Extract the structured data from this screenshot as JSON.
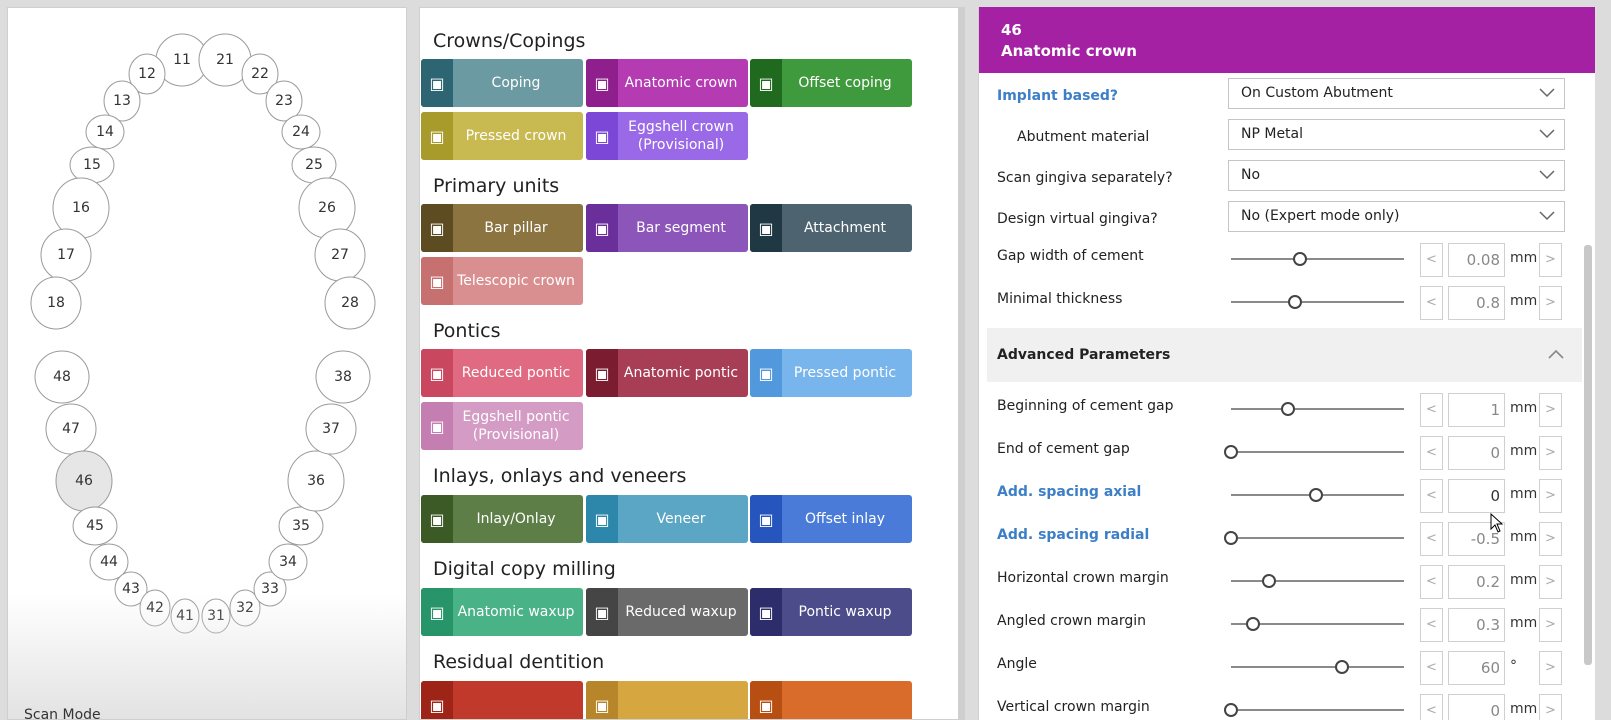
{
  "tooth_chart": {
    "teeth": [
      {
        "label": "11",
        "selected": false
      },
      {
        "label": "12",
        "selected": false
      },
      {
        "label": "13",
        "selected": false
      },
      {
        "label": "14",
        "selected": false
      },
      {
        "label": "15",
        "selected": false
      },
      {
        "label": "16",
        "selected": false
      },
      {
        "label": "17",
        "selected": false
      },
      {
        "label": "18",
        "selected": false
      },
      {
        "label": "21",
        "selected": false
      },
      {
        "label": "22",
        "selected": false
      },
      {
        "label": "23",
        "selected": false
      },
      {
        "label": "24",
        "selected": false
      },
      {
        "label": "25",
        "selected": false
      },
      {
        "label": "26",
        "selected": false
      },
      {
        "label": "27",
        "selected": false
      },
      {
        "label": "28",
        "selected": false
      },
      {
        "label": "48",
        "selected": false
      },
      {
        "label": "47",
        "selected": false
      },
      {
        "label": "46",
        "selected": true
      },
      {
        "label": "45",
        "selected": false
      },
      {
        "label": "44",
        "selected": false
      },
      {
        "label": "43",
        "selected": false
      },
      {
        "label": "42",
        "selected": false
      },
      {
        "label": "41",
        "selected": false
      },
      {
        "label": "31",
        "selected": false
      },
      {
        "label": "32",
        "selected": false
      },
      {
        "label": "33",
        "selected": false
      },
      {
        "label": "34",
        "selected": false
      },
      {
        "label": "35",
        "selected": false
      },
      {
        "label": "36",
        "selected": false
      },
      {
        "label": "37",
        "selected": false
      },
      {
        "label": "38",
        "selected": false
      }
    ],
    "scan_mode": "Scan Mode"
  },
  "types": {
    "sections": [
      {
        "title": "Crowns/Copings",
        "buttons": [
          {
            "label": "Coping",
            "color": "#6b9aa3",
            "icon_color": "#2d6672",
            "icon": "coping-icon"
          },
          {
            "label": "Anatomic crown",
            "color": "#b43bb2",
            "icon_color": "#8e1f8d",
            "icon": "anatomic-crown-icon"
          },
          {
            "label": "Offset coping",
            "color": "#3f9a3d",
            "icon_color": "#1f6a1f",
            "icon": "offset-coping-icon"
          },
          {
            "label": "Pressed crown",
            "color": "#c9b951",
            "icon_color": "#a99a2c",
            "icon": "pressed-crown-icon"
          },
          {
            "label": "Eggshell crown (Provisional)",
            "color": "#9a69e8",
            "icon_color": "#7c47d6",
            "icon": "eggshell-crown-icon"
          }
        ]
      },
      {
        "title": "Primary units",
        "buttons": [
          {
            "label": "Bar pillar",
            "color": "#8b7440",
            "icon_color": "#5d4b22",
            "icon": "bar-pillar-icon"
          },
          {
            "label": "Bar segment",
            "color": "#8c55ba",
            "icon_color": "#6a2f9a",
            "icon": "bar-segment-icon"
          },
          {
            "label": "Attachment",
            "color": "#4e6370",
            "icon_color": "#1f3844",
            "icon": "attachment-icon"
          },
          {
            "label": "Telescopic crown",
            "color": "#d98f8f",
            "icon_color": "#c77070",
            "icon": "telescopic-crown-icon"
          }
        ]
      },
      {
        "title": "Pontics",
        "buttons": [
          {
            "label": "Reduced pontic",
            "color": "#e06a81",
            "icon_color": "#c9475f",
            "icon": "reduced-pontic-icon"
          },
          {
            "label": "Anatomic pontic",
            "color": "#a73e55",
            "icon_color": "#7c1c30",
            "icon": "anatomic-pontic-icon"
          },
          {
            "label": "Pressed pontic",
            "color": "#78b5ec",
            "icon_color": "#5199dc",
            "icon": "pressed-pontic-icon"
          },
          {
            "label": "Eggshell pontic (Provisional)",
            "color": "#d49cc4",
            "icon_color": "#c57eb2",
            "icon": "eggshell-pontic-icon"
          }
        ]
      },
      {
        "title": "Inlays, onlays and veneers",
        "buttons": [
          {
            "label": "Inlay/Onlay",
            "color": "#5e7e48",
            "icon_color": "#3b5a25",
            "icon": "inlay-onlay-icon"
          },
          {
            "label": "Veneer",
            "color": "#5aa6c4",
            "icon_color": "#2d87ab",
            "icon": "veneer-icon"
          },
          {
            "label": "Offset inlay",
            "color": "#4b7bd8",
            "icon_color": "#2555bd",
            "icon": "offset-inlay-icon"
          }
        ]
      },
      {
        "title": "Digital copy milling",
        "buttons": [
          {
            "label": "Anatomic waxup",
            "color": "#49b387",
            "icon_color": "#27946a",
            "icon": "anatomic-waxup-icon"
          },
          {
            "label": "Reduced waxup",
            "color": "#6a6a6a",
            "icon_color": "#454545",
            "icon": "reduced-waxup-icon"
          },
          {
            "label": "Pontic waxup",
            "color": "#4c4c8a",
            "icon_color": "#2d2d6b",
            "icon": "pontic-waxup-icon"
          }
        ]
      },
      {
        "title": "Residual dentition",
        "buttons": [
          {
            "label": "",
            "color": "#c0392b",
            "icon_color": "#9e2418",
            "icon": "residual-icon-1"
          },
          {
            "label": "",
            "color": "#d6a640",
            "icon_color": "#b8862a",
            "icon": "residual-icon-2"
          },
          {
            "label": "",
            "color": "#d96c2a",
            "icon_color": "#b84f12",
            "icon": "residual-icon-3"
          }
        ]
      }
    ]
  },
  "params": {
    "header": {
      "tooth": "46",
      "type": "Anatomic crown",
      "color": "#a421a3"
    },
    "dropdowns": [
      {
        "label": "Implant based?",
        "value": "On Custom Abutment",
        "blue": true,
        "indent": false
      },
      {
        "label": "Abutment material",
        "value": "NP Metal",
        "blue": false,
        "indent": true
      },
      {
        "label": "Scan gingiva separately?",
        "value": "No",
        "blue": false,
        "indent": false
      },
      {
        "label": "Design virtual gingiva?",
        "value": "No (Expert mode only)",
        "blue": false,
        "indent": false
      }
    ],
    "basic_sliders": [
      {
        "label": "Gap width of cement",
        "value": "0.08",
        "unit": "mm",
        "level": 0.4,
        "blue": false,
        "active": false
      },
      {
        "label": "Minimal thickness",
        "value": "0.8",
        "unit": "mm",
        "level": 0.37,
        "blue": false,
        "active": false
      }
    ],
    "advanced_title": "Advanced Parameters",
    "advanced_sliders": [
      {
        "label": "Beginning of cement gap",
        "value": "1",
        "unit": "mm",
        "level": 0.33,
        "blue": false,
        "active": false
      },
      {
        "label": "End of cement gap",
        "value": "0",
        "unit": "mm",
        "level": 0.0,
        "blue": false,
        "active": false
      },
      {
        "label": "Add. spacing axial",
        "value": "0",
        "unit": "mm",
        "level": 0.49,
        "blue": true,
        "active": true
      },
      {
        "label": "Add. spacing radial",
        "value": "-0.5",
        "unit": "mm",
        "level": 0.0,
        "blue": true,
        "active": false
      },
      {
        "label": "Horizontal crown margin",
        "value": "0.2",
        "unit": "mm",
        "level": 0.22,
        "blue": false,
        "active": false
      },
      {
        "label": "Angled crown margin",
        "value": "0.3",
        "unit": "mm",
        "level": 0.13,
        "blue": false,
        "active": false
      },
      {
        "label": "Angle",
        "value": "60",
        "unit": "°",
        "level": 0.64,
        "blue": false,
        "active": false
      },
      {
        "label": "Vertical crown margin",
        "value": "0",
        "unit": "mm",
        "level": 0.0,
        "blue": false,
        "active": false
      }
    ],
    "step_prev": "<",
    "step_next": ">"
  }
}
